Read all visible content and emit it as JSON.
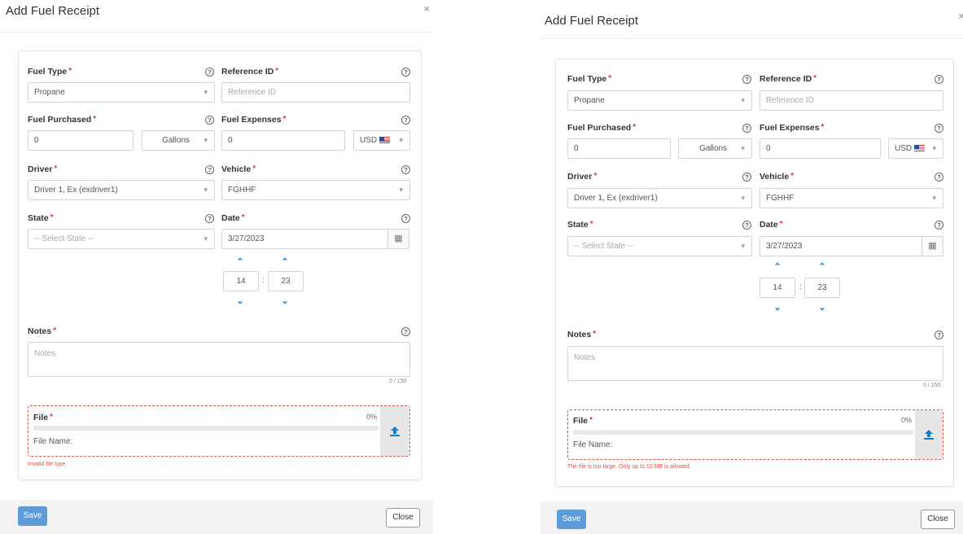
{
  "modals": [
    {
      "title": "Add Fuel Receipt",
      "close_glyph": "×",
      "fields": {
        "fuel_type": {
          "label": "Fuel Type",
          "value": "Propane"
        },
        "reference_id": {
          "label": "Reference ID",
          "placeholder": "Reference ID"
        },
        "fuel_purchased": {
          "label": "Fuel Purchased",
          "value": "0",
          "unit": "Gallons"
        },
        "fuel_expenses": {
          "label": "Fuel Expenses",
          "value": "0",
          "currency": "USD"
        },
        "driver": {
          "label": "Driver",
          "value": "Driver 1, Ex (exdriver1)"
        },
        "vehicle": {
          "label": "Vehicle",
          "value": "FGHHF"
        },
        "state": {
          "label": "State",
          "value": "-- Select State --"
        },
        "date": {
          "label": "Date",
          "value": "3/27/2023"
        },
        "time": {
          "hour": "14",
          "minute": "23",
          "separator": ":"
        },
        "notes": {
          "label": "Notes",
          "placeholder": "Notes",
          "counter": "0 / 150"
        },
        "file": {
          "label": "File",
          "progress": "0%",
          "progress_fraction": 0,
          "file_name_label": "File Name:"
        }
      },
      "error": "Invalid file type.",
      "buttons": {
        "save": "Save",
        "close": "Close"
      }
    },
    {
      "title": "Add Fuel Receipt",
      "close_glyph": "×",
      "fields": {
        "fuel_type": {
          "label": "Fuel Type",
          "value": "Propane"
        },
        "reference_id": {
          "label": "Reference ID",
          "placeholder": "Reference ID"
        },
        "fuel_purchased": {
          "label": "Fuel Purchased",
          "value": "0",
          "unit": "Gallons"
        },
        "fuel_expenses": {
          "label": "Fuel Expenses",
          "value": "0",
          "currency": "USD"
        },
        "driver": {
          "label": "Driver",
          "value": "Driver 1, Ex (exdriver1)"
        },
        "vehicle": {
          "label": "Vehicle",
          "value": "FGHHF"
        },
        "state": {
          "label": "State",
          "value": "-- Select State --"
        },
        "date": {
          "label": "Date",
          "value": "3/27/2023"
        },
        "time": {
          "hour": "14",
          "minute": "23",
          "separator": ":"
        },
        "notes": {
          "label": "Notes",
          "placeholder": "Notes",
          "counter": "0 / 150"
        },
        "file": {
          "label": "File",
          "progress": "0%",
          "progress_fraction": 0,
          "file_name_label": "File Name:"
        }
      },
      "error": "The file is too large. Only up to 10 MB is allowed.",
      "buttons": {
        "save": "Save",
        "close": "Close"
      }
    }
  ],
  "required_marker": "*",
  "help_glyph": "?",
  "icons": {
    "select_caret": "chevron-down-icon",
    "help": "help-circle-icon",
    "calendar": "calendar-icon",
    "spinner_up": "chevron-up-icon",
    "spinner_down": "chevron-down-icon",
    "upload": "upload-icon",
    "flag": "us-flag-icon"
  },
  "colors": {
    "required": "#e03a3a",
    "error": "#d9534f",
    "primary": "#5d9cd7",
    "accent": "#1b7ac6"
  }
}
